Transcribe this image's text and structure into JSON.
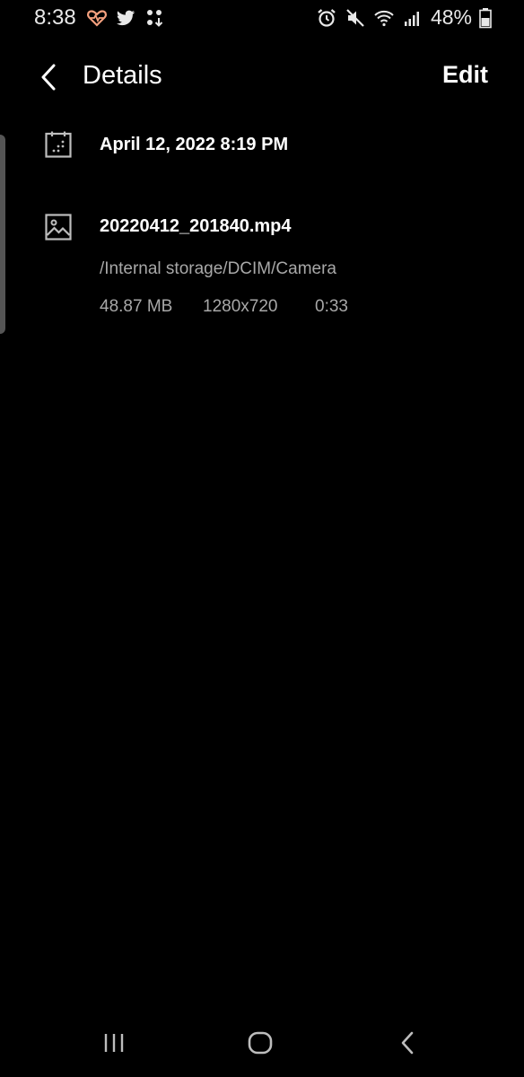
{
  "status_bar": {
    "time": "8:38",
    "battery_percent": "48%",
    "left_icons": [
      "heart-pulse-icon",
      "twitter-icon",
      "app-update-icon"
    ],
    "right_icons": [
      "alarm-icon",
      "mute-icon",
      "wifi-icon",
      "signal-icon",
      "battery-icon"
    ]
  },
  "app_bar": {
    "title": "Details",
    "edit_label": "Edit"
  },
  "details": {
    "date_time": "April 12, 2022 8:19 PM",
    "file_name": "20220412_201840.mp4",
    "file_path": "/Internal storage/DCIM/Camera",
    "size": "48.87 MB",
    "resolution": "1280x720",
    "duration": "0:33"
  },
  "nav_bar": {
    "buttons": [
      "recent-apps-icon",
      "home-icon",
      "back-icon"
    ]
  },
  "colors": {
    "background": "#000000",
    "primary_text": "#ffffff",
    "secondary_text": "#a8a8a8",
    "heart_icon": "#f4a07e"
  }
}
